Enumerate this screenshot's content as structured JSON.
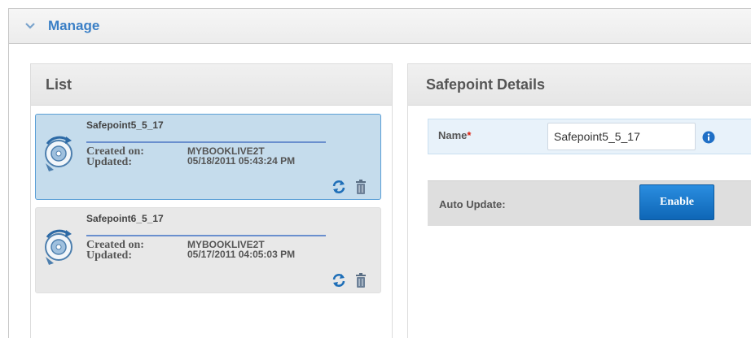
{
  "manage": {
    "title": "Manage"
  },
  "list": {
    "title": "List",
    "items": [
      {
        "name": "Safepoint5_5_17",
        "created_label": "Created on:",
        "updated_label": "Updated:",
        "created_value": "MYBOOKLIVE2T",
        "updated_value": "05/18/2011 05:43:24 PM",
        "selected": true
      },
      {
        "name": "Safepoint6_5_17",
        "created_label": "Created on:",
        "updated_label": "Updated:",
        "created_value": "MYBOOKLIVE2T",
        "updated_value": "05/17/2011 04:05:03 PM",
        "selected": false
      }
    ]
  },
  "details": {
    "title": "Safepoint Details",
    "name_label": "Name",
    "name_required_mark": "*",
    "name_value": "Safepoint5_5_17",
    "auto_update_label": "Auto Update:",
    "enable_button": "Enable"
  },
  "colors": {
    "accent_blue": "#3a7fc6",
    "selected_bg": "#c5dcec",
    "button_blue": "#1577cc"
  },
  "icons": {
    "collapse": "chevron-down-icon",
    "safepoint": "disk-restore-icon",
    "update": "refresh-icon",
    "delete": "trash-icon",
    "info": "info-icon"
  }
}
